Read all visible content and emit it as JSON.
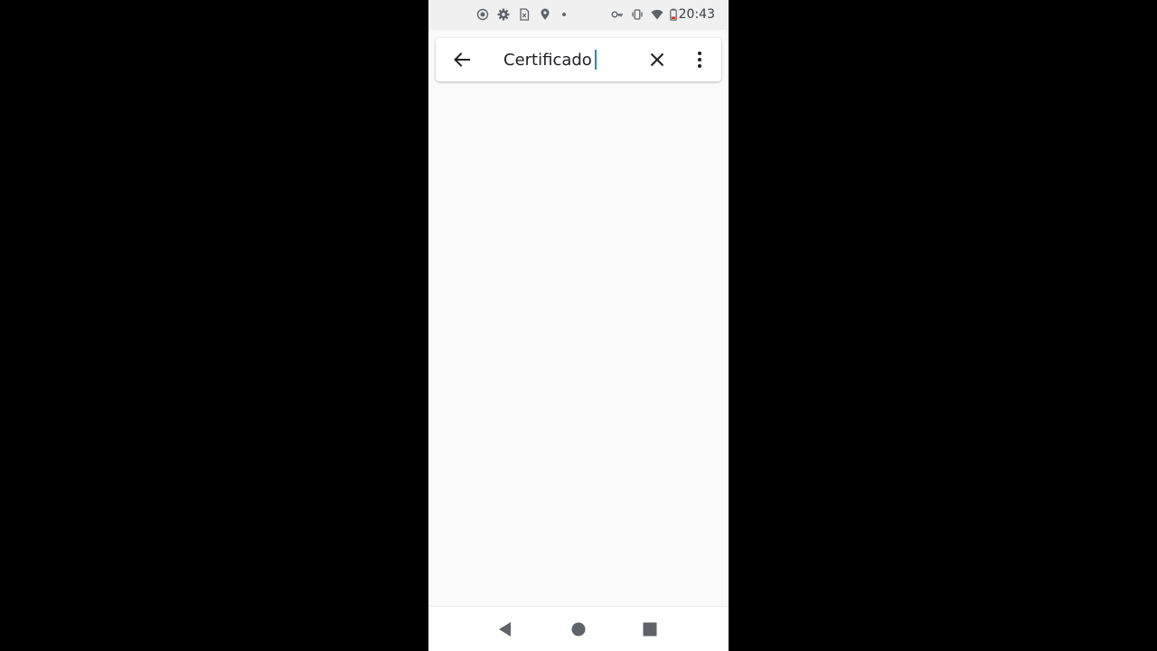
{
  "status_bar": {
    "time": "20:43",
    "left_icons": [
      "screen-record-icon",
      "settings-gear-icon",
      "sim-card-icon",
      "location-pin-icon",
      "dot-icon"
    ],
    "right_icons": [
      "vpn-key-icon",
      "vibrate-icon",
      "wifi-icon",
      "battery-icon"
    ]
  },
  "search_bar": {
    "query": "Certificado",
    "back_icon": "arrow-left-icon",
    "clear_icon": "close-icon",
    "menu_icon": "more-vertical-icon"
  },
  "nav_bar": {
    "buttons": [
      "back-triangle-icon",
      "home-circle-icon",
      "recents-square-icon"
    ]
  },
  "colors": {
    "background": "#fafafa",
    "status_bar": "#f0f0f0",
    "caret": "#1a8fb5",
    "icon": "#5f6368",
    "text": "#202124"
  }
}
